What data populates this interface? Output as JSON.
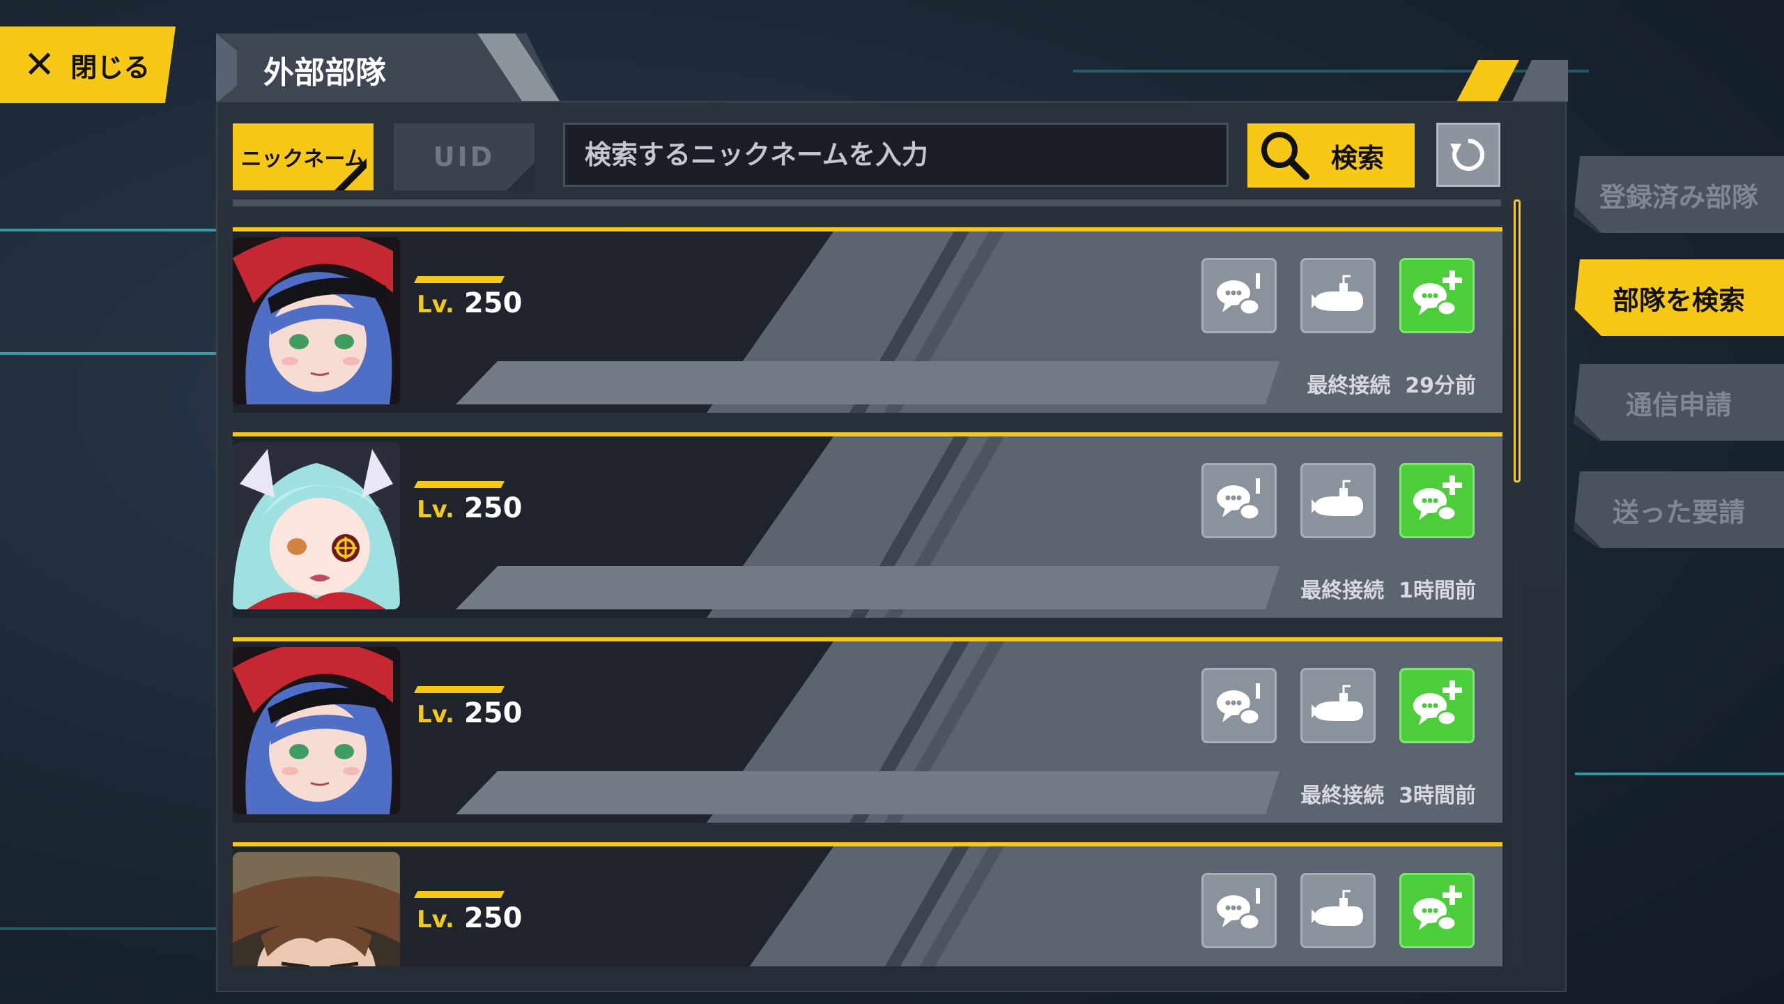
{
  "close_button": {
    "label": "閉じる",
    "icon": "close-x-icon"
  },
  "panel": {
    "title": "外部部隊"
  },
  "search": {
    "mode_nickname": "ニックネーム",
    "mode_uid": "UID",
    "placeholder": "検索するニックネームを入力",
    "search_label": "検索",
    "active_mode": "nickname"
  },
  "side_tabs": [
    {
      "label": "登録済み部隊",
      "active": false
    },
    {
      "label": "部隊を検索",
      "active": true
    },
    {
      "label": "通信申請",
      "active": false
    },
    {
      "label": "送った要請",
      "active": false
    }
  ],
  "rows": [
    {
      "level_label": "Lv.",
      "level": "250",
      "last_login_label": "最終接続",
      "last_login": "29分前",
      "avatar": "blue-hair-red-cap"
    },
    {
      "level_label": "Lv.",
      "level": "250",
      "last_login_label": "最終接続",
      "last_login": "1時間前",
      "avatar": "mint-hair-eyepatch"
    },
    {
      "level_label": "Lv.",
      "level": "250",
      "last_login_label": "最終接続",
      "last_login": "3時間前",
      "avatar": "blue-hair-red-cap"
    },
    {
      "level_label": "Lv.",
      "level": "250",
      "last_login_label": "",
      "last_login": "",
      "avatar": "brown-hair-helmet"
    }
  ],
  "row_actions": [
    "chat-info-icon",
    "submarine-icon",
    "add-friend-chat-icon"
  ],
  "colors": {
    "accent": "#f8c816",
    "add_button": "#4ccd3a",
    "panel": "#262d37"
  }
}
